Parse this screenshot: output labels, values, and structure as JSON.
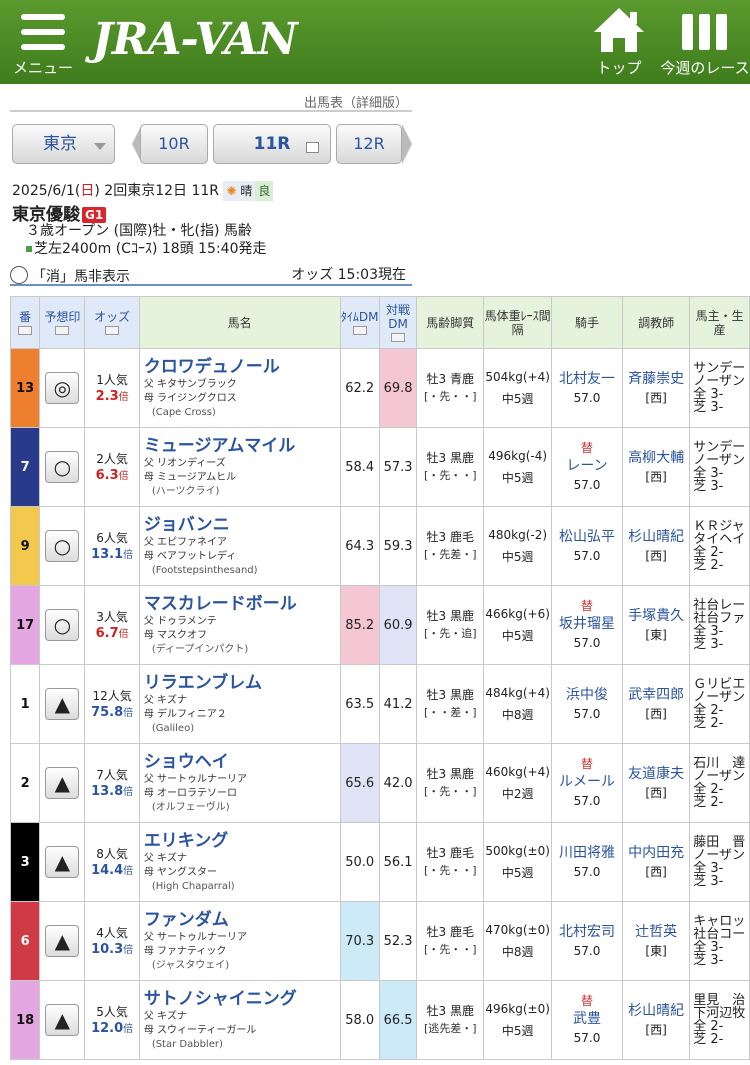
{
  "header": {
    "menu_label": "メニュー",
    "logo": "JRA-VAN",
    "top_label": "トップ",
    "week_label": "今週のレース"
  },
  "page_subtitle": "出馬表（詳細版）",
  "nav": {
    "venue": "東京",
    "prev_race": "10R",
    "current_race": "11R",
    "next_race": "12R"
  },
  "race_info": {
    "date": "2025/6/1",
    "weekday": "日",
    "meeting": "2回東京12日 11R",
    "weather": "晴",
    "going": "良",
    "name": "東京優駿",
    "grade": "G1",
    "conditions": "３歳オープン (国際)牡・牝(指) 馬齢",
    "course": "芝左2400m (Cｺｰｽ) 18頭 15:40発走"
  },
  "options": {
    "scratch_toggle_label": "「消」馬非表示",
    "odds_time": "オッズ 15:03現在"
  },
  "table": {
    "headers": [
      "番",
      "予想印",
      "オッズ",
      "馬名",
      "ﾀｲﾑDM",
      "対戦DM",
      "馬齢脚質",
      "馬体重ﾚｰｽ間隔",
      "騎手",
      "調教師",
      "馬主・生産"
    ],
    "colors": {
      "dm_high": "#f5c6d3",
      "dm_mid": "#e0e3f5",
      "dm_low": "#cdeaf8"
    },
    "rows": [
      {
        "num": "13",
        "frame": "#ee7f2e",
        "mark": "◎",
        "pop": "1人気",
        "odds": "2.3",
        "odds_color": "#cc2222",
        "name": "クロワデュノール",
        "sire": "父 キタサンブラック",
        "dam": "母 ライジングクロス",
        "gs": "(Cape Cross)",
        "tdm": "62.2",
        "tdm_bg": "",
        "vdm": "69.8",
        "vdm_bg": "#f5c6d3",
        "sex": "牡3 青鹿",
        "style": "[・先・・]",
        "weight": "504kg(+4)",
        "interval": "中5週",
        "sub": "",
        "jockey": "北村友一",
        "jw": "57.0",
        "trainer": "斉藤崇史",
        "belong": "[西]",
        "owner": "サンデー",
        "breeder": "ノーザン",
        "rec1": "全 3-",
        "rec2": "芝 3-"
      },
      {
        "num": "7",
        "frame": "#2a3a8a",
        "mark": "○",
        "pop": "2人気",
        "odds": "6.3",
        "odds_color": "#cc2222",
        "name": "ミュージアムマイル",
        "sire": "父 リオンディーズ",
        "dam": "母 ミュージアムヒル",
        "gs": "(ハーツクライ)",
        "tdm": "58.4",
        "tdm_bg": "",
        "vdm": "57.3",
        "vdm_bg": "",
        "sex": "牡3 黒鹿",
        "style": "[・先・・]",
        "weight": "496kg(-4)",
        "interval": "中5週",
        "sub": "替",
        "jockey": "レーン",
        "jw": "57.0",
        "trainer": "高柳大輔",
        "belong": "[西]",
        "owner": "サンデー",
        "breeder": "ノーザン",
        "rec1": "全 3-",
        "rec2": "芝 3-"
      },
      {
        "num": "9",
        "frame": "#f2c94c",
        "mark": "○",
        "pop": "6人気",
        "odds": "13.1",
        "odds_color": "#2a54a0",
        "name": "ジョバンニ",
        "sire": "父 エピファネイア",
        "dam": "母 ベアフットレディ",
        "gs": "(Footstepsinthesand)",
        "tdm": "64.3",
        "tdm_bg": "",
        "vdm": "59.3",
        "vdm_bg": "",
        "sex": "牡3 鹿毛",
        "style": "[・先差・]",
        "weight": "480kg(-2)",
        "interval": "中5週",
        "sub": "",
        "jockey": "松山弘平",
        "jw": "57.0",
        "trainer": "杉山晴紀",
        "belong": "[西]",
        "owner": "ＫＲジャ",
        "breeder": "タイヘイ",
        "rec1": "全 2-",
        "rec2": "芝 2-"
      },
      {
        "num": "17",
        "frame": "#e5a7e2",
        "mark": "○",
        "pop": "3人気",
        "odds": "6.7",
        "odds_color": "#cc2222",
        "name": "マスカレードボール",
        "sire": "父 ドゥラメンテ",
        "dam": "母 マスクオフ",
        "gs": "(ディープインパクト)",
        "tdm": "85.2",
        "tdm_bg": "#f5c6d3",
        "vdm": "60.9",
        "vdm_bg": "#e0e3f5",
        "sex": "牡3 黒鹿",
        "style": "[・先・追]",
        "weight": "466kg(+6)",
        "interval": "中5週",
        "sub": "替",
        "jockey": "坂井瑠星",
        "jw": "57.0",
        "trainer": "手塚貴久",
        "belong": "[東]",
        "owner": "社台レー",
        "breeder": "社台ファ",
        "rec1": "全 3-",
        "rec2": "芝 3-"
      },
      {
        "num": "1",
        "frame": "#ffffff",
        "mark": "▲",
        "pop": "12人気",
        "odds": "75.8",
        "odds_color": "#2a54a0",
        "name": "リラエンブレム",
        "sire": "父 キズナ",
        "dam": "母 デルフィニア２",
        "gs": "(Galileo)",
        "tdm": "63.5",
        "tdm_bg": "",
        "vdm": "41.2",
        "vdm_bg": "",
        "sex": "牡3 黒鹿",
        "style": "[・・差・]",
        "weight": "484kg(+4)",
        "interval": "中8週",
        "sub": "",
        "jockey": "浜中俊",
        "jw": "57.0",
        "trainer": "武幸四郎",
        "belong": "[西]",
        "owner": "Ｇリビエ",
        "breeder": "ノーザン",
        "rec1": "全 2-",
        "rec2": "芝 2-"
      },
      {
        "num": "2",
        "frame": "#ffffff",
        "mark": "▲",
        "pop": "7人気",
        "odds": "13.8",
        "odds_color": "#2a54a0",
        "name": "ショウヘイ",
        "sire": "父 サートゥルナーリア",
        "dam": "母 オーロラテソーロ",
        "gs": "(オルフェーヴル)",
        "tdm": "65.6",
        "tdm_bg": "#e0e3f5",
        "vdm": "42.0",
        "vdm_bg": "",
        "sex": "牡3 黒鹿",
        "style": "[・先・・]",
        "weight": "460kg(+4)",
        "interval": "中2週",
        "sub": "替",
        "jockey": "ルメール",
        "jw": "57.0",
        "trainer": "友道康夫",
        "belong": "[西]",
        "owner": "石川　達",
        "breeder": "ノーザン",
        "rec1": "全 2-",
        "rec2": "芝 2-"
      },
      {
        "num": "3",
        "frame": "#000000",
        "mark": "▲",
        "pop": "8人気",
        "odds": "14.4",
        "odds_color": "#2a54a0",
        "name": "エリキング",
        "sire": "父 キズナ",
        "dam": "母 ヤングスター",
        "gs": "(High Chaparral)",
        "tdm": "50.0",
        "tdm_bg": "",
        "vdm": "56.1",
        "vdm_bg": "",
        "sex": "牡3 鹿毛",
        "style": "[・先・・]",
        "weight": "500kg(±0)",
        "interval": "中5週",
        "sub": "",
        "jockey": "川田将雅",
        "jw": "57.0",
        "trainer": "中内田充",
        "belong": "[西]",
        "owner": "藤田　晋",
        "breeder": "ノーザン",
        "rec1": "全 3-",
        "rec2": "芝 3-"
      },
      {
        "num": "6",
        "frame": "#d03a45",
        "mark": "▲",
        "pop": "4人気",
        "odds": "10.3",
        "odds_color": "#2a54a0",
        "name": "ファンダム",
        "sire": "父 サートゥルナーリア",
        "dam": "母 ファナティック",
        "gs": "(ジャスタウェイ)",
        "tdm": "70.3",
        "tdm_bg": "#cdeaf8",
        "vdm": "52.3",
        "vdm_bg": "",
        "sex": "牡3 鹿毛",
        "style": "[・先・・]",
        "weight": "470kg(±0)",
        "interval": "中8週",
        "sub": "",
        "jockey": "北村宏司",
        "jw": "57.0",
        "trainer": "辻哲英",
        "belong": "[東]",
        "owner": "キャロッ",
        "breeder": "社台コー",
        "rec1": "全 3-",
        "rec2": "芝 3-"
      },
      {
        "num": "18",
        "frame": "#e5a7e2",
        "mark": "▲",
        "pop": "5人気",
        "odds": "12.0",
        "odds_color": "#2a54a0",
        "name": "サトノシャイニング",
        "sire": "父 キズナ",
        "dam": "母 スウィーティーガール",
        "gs": "(Star Dabbler)",
        "tdm": "58.0",
        "tdm_bg": "",
        "vdm": "66.5",
        "vdm_bg": "#cdeaf8",
        "sex": "牡3 黒鹿",
        "style": "[逃先差・]",
        "weight": "496kg(±0)",
        "interval": "中5週",
        "sub": "替",
        "jockey": "武豊",
        "jw": "57.0",
        "trainer": "杉山晴紀",
        "belong": "[西]",
        "owner": "里見　治",
        "breeder": "下河辺牧",
        "rec1": "全 2-",
        "rec2": "芝 2-"
      }
    ]
  }
}
